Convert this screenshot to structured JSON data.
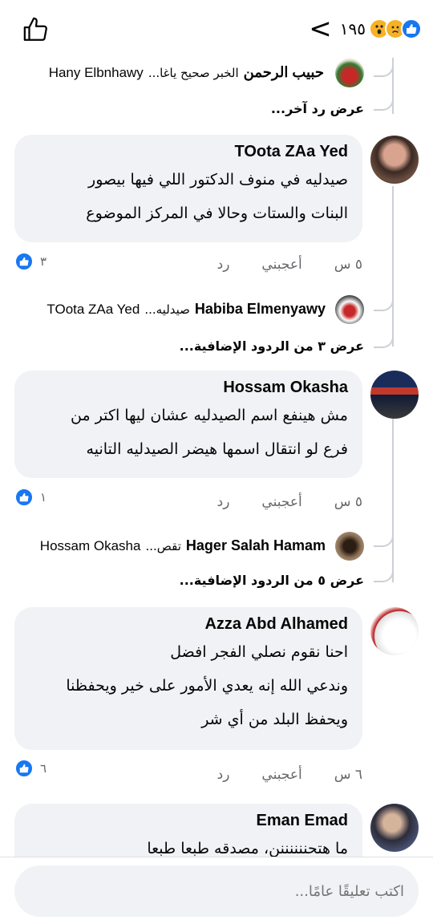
{
  "header": {
    "reaction_count": "١٩٥",
    "back_glyph": "<",
    "reactions": [
      "like-icon",
      "sad-icon",
      "wow-icon"
    ]
  },
  "thread": {
    "top_reply": {
      "name": "حبيب الرحمن",
      "snippet": "الخبر صحيح ياغا...",
      "reply_to": "Hany Elbnhawy"
    },
    "top_more": "عرض رد آخر...",
    "comments": [
      {
        "author": "TOota ZAa Yed",
        "lines": [
          "صيدليه في منوف الدكتور اللي فيها بيصور",
          "البنات والستات وحالا في المركز الموضوع"
        ],
        "time": "٥ س",
        "like": "أعجبني",
        "reply": "رد",
        "likes": "٣",
        "reply_preview": {
          "name": "Habiba Elmenyawy",
          "snippet": "صيدليه...",
          "reply_to": "TOota ZAa Yed"
        },
        "more": "عرض ٣ من الردود الإضافية..."
      },
      {
        "author": "Hossam Okasha",
        "lines": [
          "مش هينفع اسم الصيدليه عشان ليها اكتر من",
          "فرع لو انتقال اسمها هيضر الصيدليه التانيه"
        ],
        "time": "٥ س",
        "like": "أعجبني",
        "reply": "رد",
        "likes": "١",
        "reply_preview": {
          "name": "Hager Salah Hamam",
          "snippet": "تقص...",
          "reply_to": "Hossam Okasha"
        },
        "more": "عرض ٥ من الردود الإضافية..."
      },
      {
        "author": "Azza Abd Alhamed",
        "lines": [
          "احنا نقوم نصلي الفجر افضل",
          "وندعي الله إنه يعدي الأمور على خير ويحفظنا",
          "ويحفظ البلد من أي شر"
        ],
        "time": "٦ س",
        "like": "أعجبني",
        "reply": "رد",
        "likes": "٦"
      },
      {
        "author": "Eman Emad",
        "lines": [
          "ما هتحننننننن، مصدقه طبعا طبعا"
        ]
      }
    ]
  },
  "composer": {
    "placeholder": "اكتب تعليقًا عامًا..."
  },
  "colors": {
    "accent": "#1877f2",
    "bubble": "#f0f2f5",
    "meta": "#65676b"
  }
}
